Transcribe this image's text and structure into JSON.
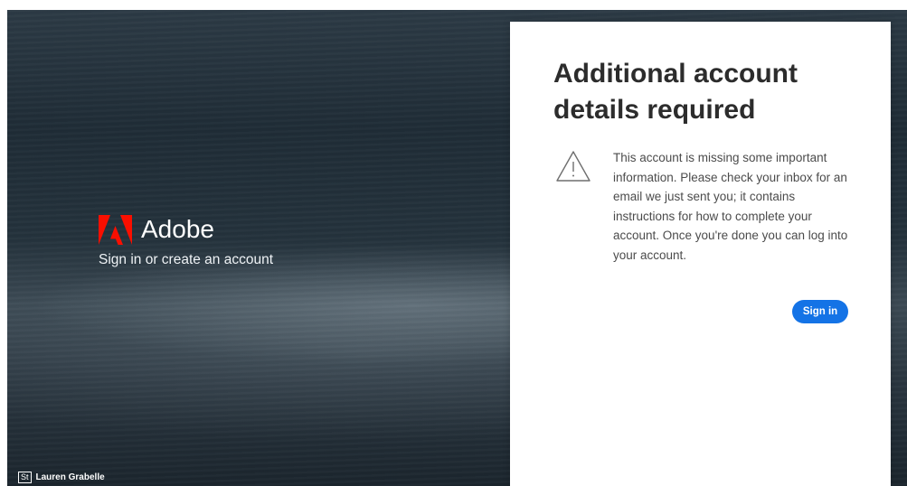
{
  "left_panel": {
    "brand_name": "Adobe",
    "tagline": "Sign in or create an account",
    "photo_credit": {
      "badge": "St",
      "name": "Lauren Grabelle"
    }
  },
  "card": {
    "title": "Additional account details required",
    "icon": "warning-triangle-icon",
    "message": "This account is missing some important information. Please check your inbox for an email we just sent you; it contains instructions for how to complete your account. Once you're done you can log into your account.",
    "button_label": "Sign in"
  },
  "colors": {
    "brand_red": "#fa0f00",
    "accent_blue": "#1473e6"
  }
}
